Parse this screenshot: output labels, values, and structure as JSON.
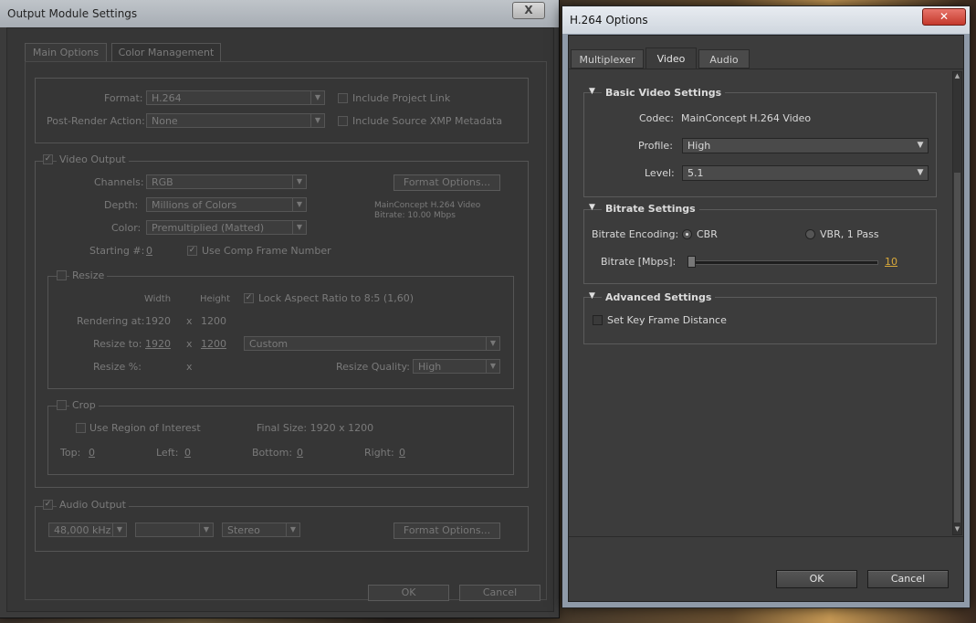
{
  "output_module": {
    "title": "Output Module Settings",
    "close": "X",
    "tabs": [
      "Main Options",
      "Color Management"
    ],
    "format_label": "Format:",
    "format_value": "H.264",
    "post_render_label": "Post-Render Action:",
    "post_render_value": "None",
    "include_project_link": "Include Project Link",
    "include_xmp": "Include Source XMP Metadata",
    "video_output": "Video Output",
    "channels_label": "Channels:",
    "channels_value": "RGB",
    "depth_label": "Depth:",
    "depth_value": "Millions of Colors",
    "color_label": "Color:",
    "color_value": "Premultiplied (Matted)",
    "starting_label": "Starting #:",
    "starting_value": "0",
    "use_comp_frame": "Use Comp Frame Number",
    "format_options": "Format Options...",
    "codec_info_1": "MainConcept H.264 Video",
    "codec_info_2": "Bitrate: 10.00 Mbps",
    "resize": "Resize",
    "width_h": "Width",
    "height_h": "Height",
    "lock_aspect": "Lock Aspect Ratio to 8:5 (1,60)",
    "rendering_at_label": "Rendering at:",
    "rendering_w": "1920",
    "rendering_x": "x",
    "rendering_h": "1200",
    "resize_to_label": "Resize to:",
    "resize_to_w": "1920",
    "resize_to_x": "x",
    "resize_to_h": "1200",
    "resize_to_preset": "Custom",
    "resize_pct_label": "Resize %:",
    "resize_pct_x": "x",
    "resize_quality_label": "Resize Quality:",
    "resize_quality_value": "High",
    "crop": "Crop",
    "use_roi": "Use Region of Interest",
    "final_size": "Final Size: 1920 x 1200",
    "top_label": "Top:",
    "top_value": "0",
    "left_label": "Left:",
    "left_value": "0",
    "bottom_label": "Bottom:",
    "bottom_value": "0",
    "right_label": "Right:",
    "right_value": "0",
    "audio_output": "Audio Output",
    "audio_rate": "48,000 kHz",
    "audio_channels": "Stereo",
    "audio_format_options": "Format Options...",
    "ok": "OK",
    "cancel": "Cancel"
  },
  "h264": {
    "title": "H.264 Options",
    "tabs": [
      "Multiplexer",
      "Video",
      "Audio"
    ],
    "active_tab": "Video",
    "basic_header": "Basic Video Settings",
    "codec_label": "Codec:",
    "codec_value": "MainConcept H.264 Video",
    "profile_label": "Profile:",
    "profile_value": "High",
    "level_label": "Level:",
    "level_value": "5.1",
    "bitrate_header": "Bitrate Settings",
    "encoding_label": "Bitrate Encoding:",
    "cbr": "CBR",
    "vbr": "VBR, 1 Pass",
    "encoding_selected": "CBR",
    "bitrate_label": "Bitrate [Mbps]:",
    "bitrate_value": "10",
    "bitrate_slider_fraction": 0.0,
    "advanced_header": "Advanced Settings",
    "set_key_frame": "Set Key Frame Distance",
    "ok": "OK",
    "cancel": "Cancel"
  },
  "colors": {
    "accent_value": "#d9a93a",
    "close_red": "#c4392c"
  }
}
